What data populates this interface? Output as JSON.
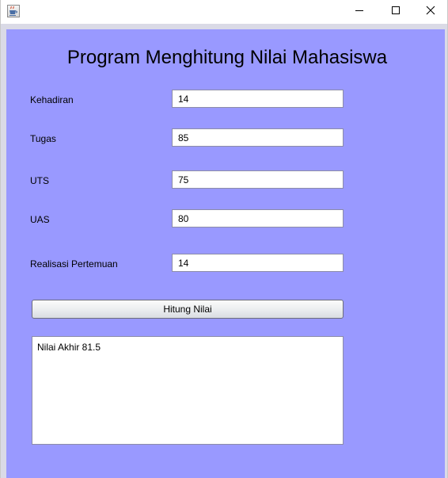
{
  "window": {
    "app_icon": "java-coffee-cup-icon",
    "controls": {
      "minimize_icon": "minimize-icon",
      "maximize_icon": "maximize-icon",
      "close_icon": "close-icon"
    }
  },
  "form": {
    "title": "Program Menghitung Nilai Mahasiswa",
    "fields": {
      "kehadiran": {
        "label": "Kehadiran",
        "value": "14"
      },
      "tugas": {
        "label": "Tugas",
        "value": "85"
      },
      "uts": {
        "label": "UTS",
        "value": "75"
      },
      "uas": {
        "label": "UAS",
        "value": "80"
      },
      "realisasi": {
        "label": "Realisasi Pertemuan",
        "value": "14"
      }
    },
    "button_label": "Hitung Nilai",
    "result_text": "Nilai Akhir 81.5"
  },
  "colors": {
    "panel_background": "#9999ff",
    "frame_background": "#dadae6",
    "field_background": "#ffffff"
  }
}
